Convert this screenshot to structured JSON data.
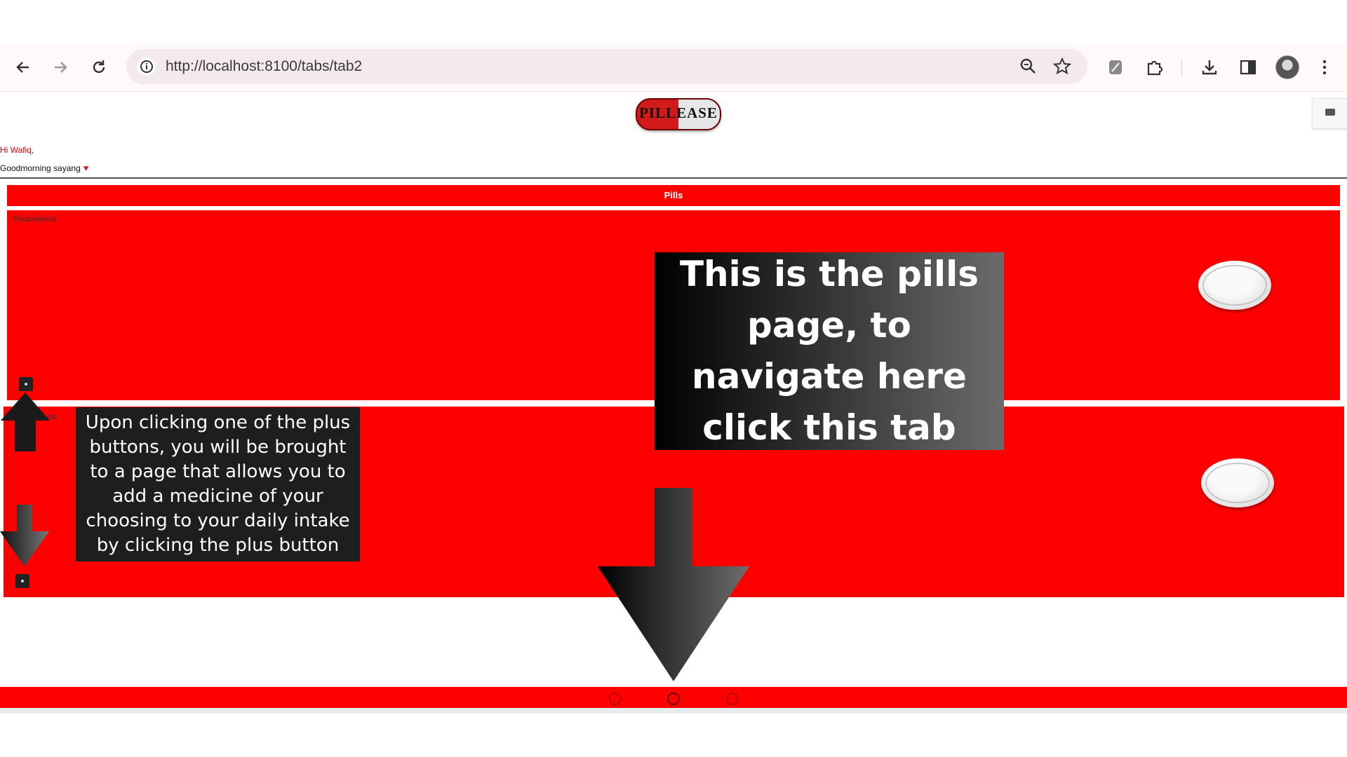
{
  "browser": {
    "url": "http://localhost:8100/tabs/tab2",
    "icons": [
      "back-icon",
      "forward-icon",
      "reload-icon",
      "site-info-icon",
      "zoom-icon",
      "bookmark-star-icon",
      "extension-pen-icon",
      "extensions-puzzle-icon",
      "download-icon",
      "side-panel-icon",
      "profile-avatar",
      "more-menu-icon"
    ]
  },
  "app": {
    "logo_text": "PILLEASE",
    "greeting_name": "Hi Wafiq,",
    "greeting_message": "Goodmorning sayang",
    "section_title": "Pills",
    "pills": [
      {
        "name": "Paracetemol"
      },
      {
        "name": "...ole"
      }
    ]
  },
  "tutorial": {
    "main_callout": "This is the pills page,  to navigate here click this tab",
    "plus_callout": "Upon clicking one of the plus buttons, you will be brought to a page that allows you to add a medicine of your choosing to your daily intake by clicking the plus button"
  },
  "colors": {
    "accent": "#ff0000",
    "greeting_name": "#e00000",
    "callout_bg": "#1e1e1e"
  }
}
